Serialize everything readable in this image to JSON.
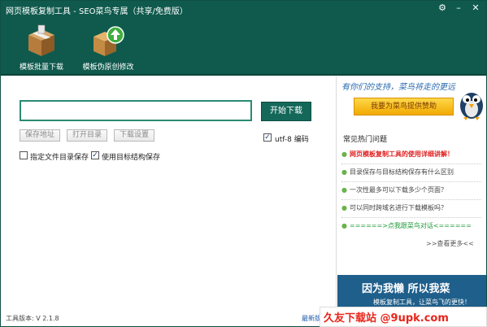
{
  "window": {
    "title": "网页模板复制工具 - SEO菜鸟专属（共享/免费版）",
    "controls": [
      "settings-icon",
      "minimize-icon",
      "close-icon"
    ]
  },
  "toolbar": {
    "items": [
      {
        "label": "模板批量下载",
        "icon": "package-box-icon"
      },
      {
        "label": "模板伪原创修改",
        "icon": "box-upload-icon"
      }
    ]
  },
  "main": {
    "url_value": "",
    "start_label": "开始下载",
    "buttons": [
      "保存地址",
      "打开目录",
      "下载设置"
    ],
    "utf8_label": "utf-8 编码",
    "utf8_checked": true,
    "option1_label": "指定文件目录保存",
    "option1_checked": false,
    "option2_label": "使用目标结构保存",
    "option2_checked": true
  },
  "sidebar": {
    "support_text": "有你们的支持，菜鸟将走的更远",
    "sponsor_label": "我要为菜鸟提供赞助",
    "faq_title": "常见热门问题",
    "faq": [
      {
        "text": "网页模板复制工具的使用详细讲解！",
        "color": "#e02020",
        "bold": true
      },
      {
        "text": "目录保存与目标结构保存有什么区别",
        "color": "#444444",
        "bold": false
      },
      {
        "text": "一次性最多可以下载多少个页面？",
        "color": "#444444",
        "bold": false
      },
      {
        "text": "可以同时跨域名进行下载模板吗？",
        "color": "#444444",
        "bold": false
      },
      {
        "text": "======>点我跟菜鸟对话<======",
        "color": "#1f9a3a",
        "bold": false
      }
    ],
    "more_link": ">>查看更多<<"
  },
  "banner": {
    "line1": "因为我懒 所以我菜",
    "line2": "模板复制工具，让菜鸟飞的更快！"
  },
  "footer": {
    "version": "工具版本: V 2.1.8",
    "newest": "最新版"
  },
  "watermark": {
    "text": "久友下载站 @9upk.com"
  },
  "colors": {
    "header_bg": "#0f5a4d",
    "accent_button": "#14685a",
    "sponsor_button": "#f0a900"
  }
}
